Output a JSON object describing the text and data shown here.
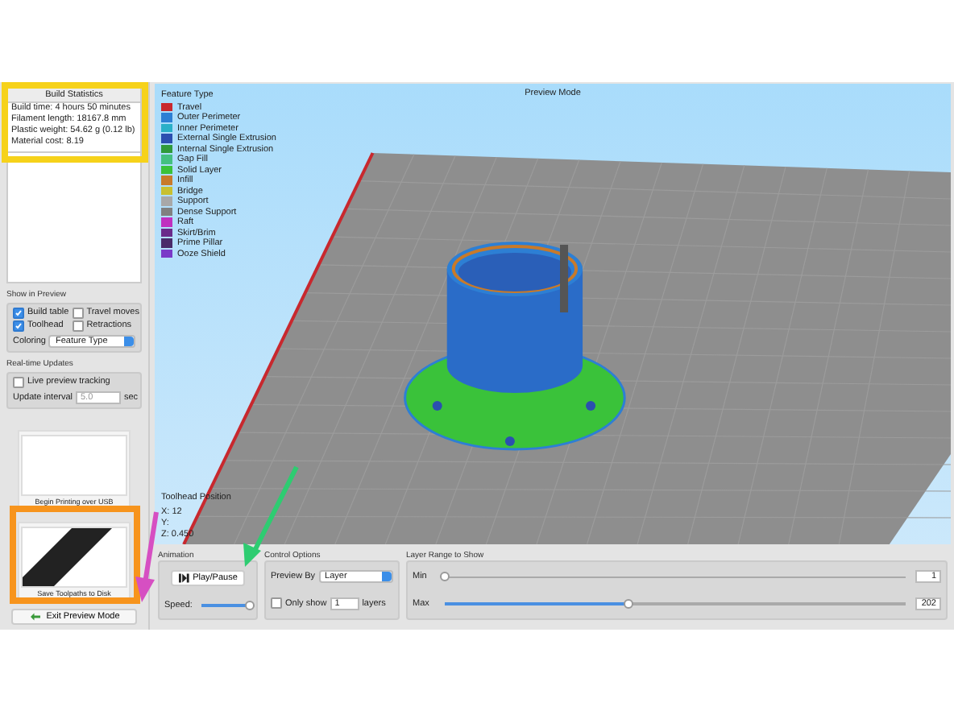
{
  "build_statistics": {
    "title": "Build Statistics",
    "lines": [
      "Build time: 4 hours 50 minutes",
      "Filament length: 18167.8 mm",
      "Plastic weight: 54.62 g (0.12 lb)",
      "Material cost: 8.19"
    ]
  },
  "show_in_preview": {
    "title": "Show in Preview",
    "options": [
      {
        "label": "Build table",
        "checked": true
      },
      {
        "label": "Travel moves",
        "checked": false
      },
      {
        "label": "Toolhead",
        "checked": true
      },
      {
        "label": "Retractions",
        "checked": false
      }
    ],
    "coloring_label": "Coloring",
    "coloring_value": "Feature Type"
  },
  "realtime_updates": {
    "title": "Real-time Updates",
    "live_tracking": {
      "label": "Live preview tracking",
      "checked": false
    },
    "interval_label": "Update interval",
    "interval_value": "5.0",
    "interval_unit": "sec"
  },
  "actions": [
    {
      "caption": "Begin Printing over USB"
    },
    {
      "caption": "Save Toolpaths to Disk"
    }
  ],
  "exit_button": "Exit Preview Mode",
  "viewport": {
    "title": "Preview Mode",
    "legend_title": "Feature Type",
    "legend": [
      {
        "label": "Travel",
        "color": "#c8282e"
      },
      {
        "label": "Outer Perimeter",
        "color": "#2d7fd4"
      },
      {
        "label": "Inner Perimeter",
        "color": "#2ab0c8"
      },
      {
        "label": "External Single Extrusion",
        "color": "#2b4fb0"
      },
      {
        "label": "Internal Single Extrusion",
        "color": "#2f9a3a"
      },
      {
        "label": "Gap Fill",
        "color": "#43c080"
      },
      {
        "label": "Solid Layer",
        "color": "#3ac23a"
      },
      {
        "label": "Infill",
        "color": "#c87a2a"
      },
      {
        "label": "Bridge",
        "color": "#c8c030"
      },
      {
        "label": "Support",
        "color": "#a8a8a8"
      },
      {
        "label": "Dense Support",
        "color": "#808080"
      },
      {
        "label": "Raft",
        "color": "#c030c0"
      },
      {
        "label": "Skirt/Brim",
        "color": "#6a2a8a"
      },
      {
        "label": "Prime Pillar",
        "color": "#4a2a6a"
      },
      {
        "label": "Ooze Shield",
        "color": "#7a3ac8"
      }
    ],
    "toolhead_title": "Toolhead Position",
    "toolhead_lines": [
      "X: 12",
      "Y:",
      "Z: 0.450"
    ]
  },
  "animation": {
    "title": "Animation",
    "play_button": "Play/Pause",
    "speed_label": "Speed:",
    "speed": {
      "level": 1.0
    }
  },
  "control_options": {
    "title": "Control Options",
    "preview_by_label": "Preview By",
    "preview_by_value": "Layer",
    "only_show": {
      "label": "Only show",
      "checked": false
    },
    "only_show_value": "1",
    "only_show_unit": "layers"
  },
  "layer_range": {
    "title": "Layer Range to Show",
    "min": {
      "label": "Min",
      "level": 0.0,
      "value": "1"
    },
    "max": {
      "label": "Max",
      "level": 0.4,
      "value": "202"
    }
  }
}
